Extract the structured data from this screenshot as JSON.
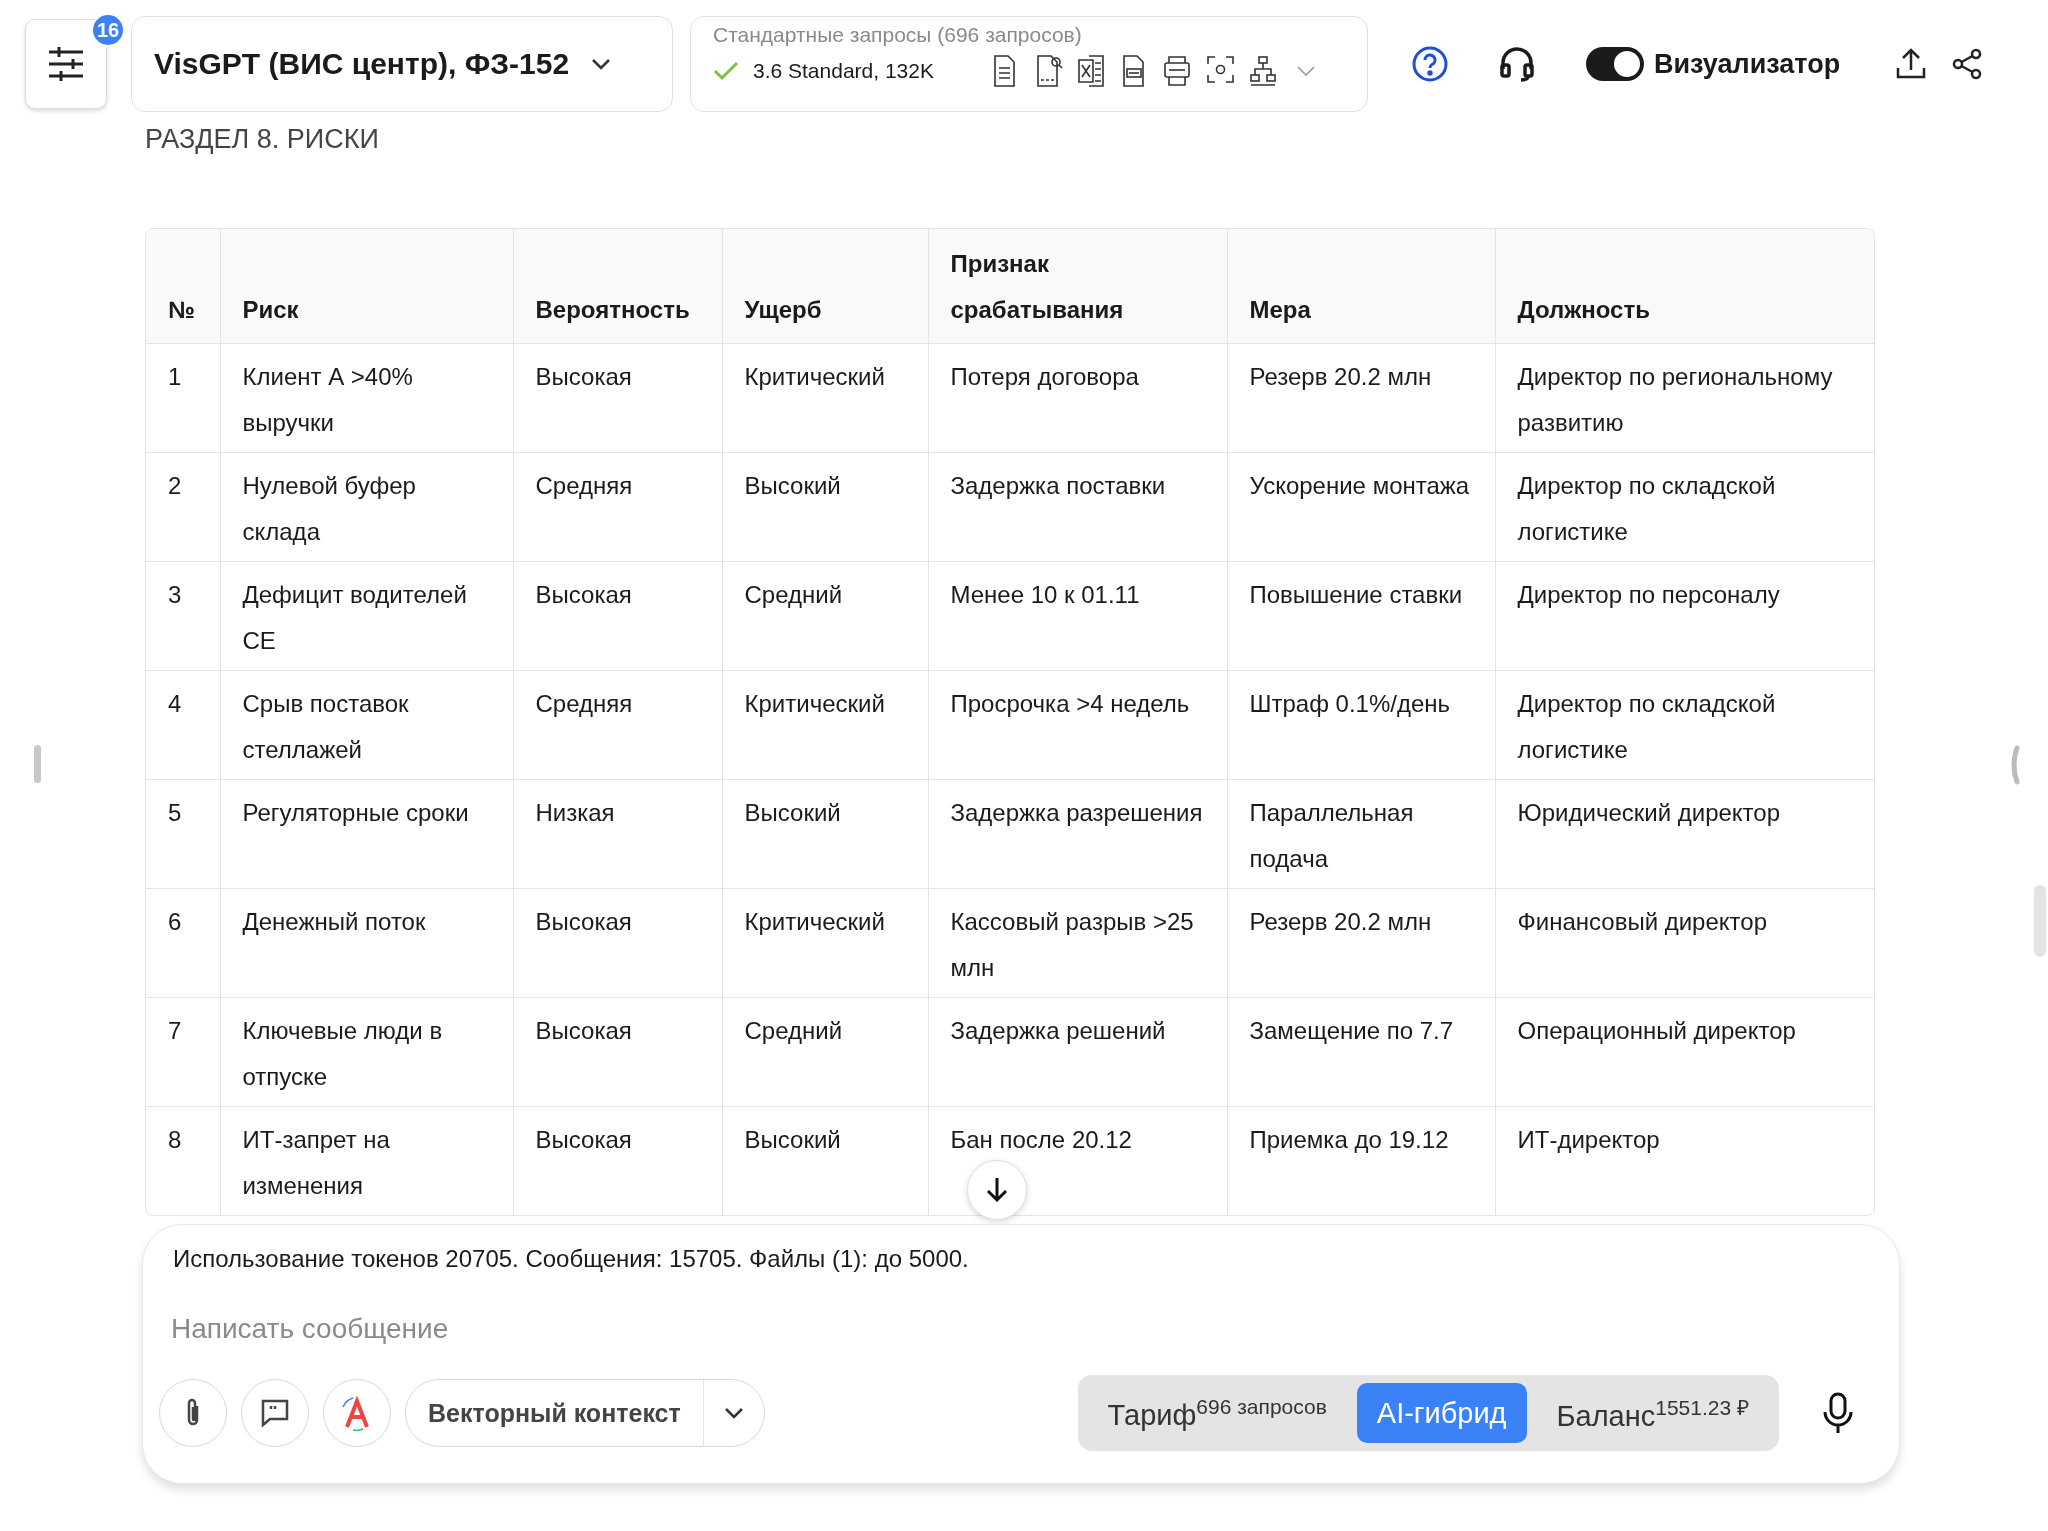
{
  "header": {
    "settings_badge": "16",
    "model": "VisGPT (ВИС центр), ФЗ-152",
    "requests_label": "Стандартные запросы (696 запросов)",
    "model_version": "3.6 Standard, 132K",
    "visualizer": {
      "label": "Визуализатор",
      "on": true
    }
  },
  "section_title": "РАЗДЕЛ 8. РИСКИ",
  "table": {
    "columns": [
      "№",
      "Риск",
      "Вероятность",
      "Ущерб",
      "Признак срабатывания",
      "Мера",
      "Должность"
    ],
    "rows": [
      [
        "1",
        "Клиент А >40% выручки",
        "Высокая",
        "Критический",
        "Потеря договора",
        "Резерв 20.2 млн",
        "Директор по региональному развитию"
      ],
      [
        "2",
        "Нулевой буфер склада",
        "Средняя",
        "Высокий",
        "Задержка поставки",
        "Ускорение монтажа",
        "Директор по складской логистике"
      ],
      [
        "3",
        "Дефицит водителей СЕ",
        "Высокая",
        "Средний",
        "Менее 10 к 01.11",
        "Повышение ставки",
        "Директор по персоналу"
      ],
      [
        "4",
        "Срыв поставок стеллажей",
        "Средняя",
        "Критический",
        "Просрочка >4 недель",
        "Штраф 0.1%/день",
        "Директор по складской логистике"
      ],
      [
        "5",
        "Регуляторные сроки",
        "Низкая",
        "Высокий",
        "Задержка разрешения",
        "Параллельная подача",
        "Юридический директор"
      ],
      [
        "6",
        "Денежный поток",
        "Высокая",
        "Критический",
        "Кассовый разрыв >25 млн",
        "Резерв 20.2 млн",
        "Финансовый директор"
      ],
      [
        "7",
        "Ключевые люди в отпуске",
        "Высокая",
        "Средний",
        "Задержка решений",
        "Замещение по 7.7",
        "Операционный директор"
      ],
      [
        "8",
        "ИТ-запрет на изменения",
        "Высокая",
        "Высокий",
        "Бан после 20.12",
        "Приемка до 19.12",
        "ИТ-директор"
      ]
    ]
  },
  "composer": {
    "usage": "Использование токенов 20705. Сообщения: 15705. Файлы (1): до 5000.",
    "placeholder": "Написать сообщение",
    "context_button": "Векторный контекст",
    "modes": [
      {
        "label": "Тариф",
        "sup": "696 запросов",
        "selected": false
      },
      {
        "label": "AI-гибрид",
        "selected": true
      },
      {
        "label": "Баланс",
        "sup": "1551.23 ₽",
        "selected": false
      }
    ]
  }
}
